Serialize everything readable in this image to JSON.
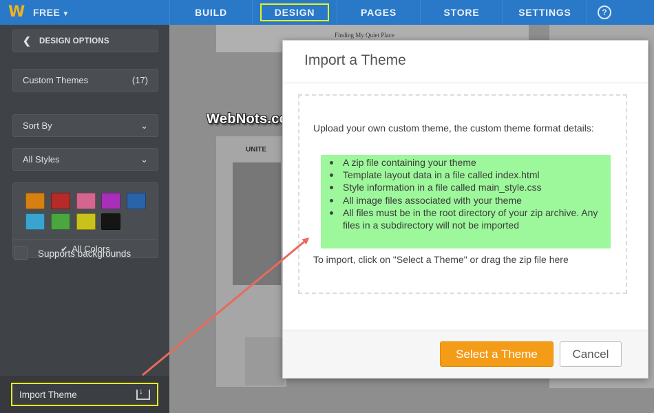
{
  "topbar": {
    "logo": "W",
    "plan": "FREE",
    "nav": [
      {
        "label": "BUILD"
      },
      {
        "label": "DESIGN"
      },
      {
        "label": "PAGES"
      },
      {
        "label": "STORE"
      },
      {
        "label": "SETTINGS"
      }
    ],
    "help": "?"
  },
  "sidebar": {
    "back_label": "DESIGN OPTIONS",
    "custom_themes_label": "Custom Themes",
    "custom_themes_count": "(17)",
    "sort_label": "Sort By",
    "styles_label": "All Styles",
    "swatch_colors": [
      "#d5800f",
      "#b62a27",
      "#d3658f",
      "#a92fbb",
      "#2963a9",
      "#3aa3cf",
      "#4aa63f",
      "#c9c21b",
      "#151515"
    ],
    "all_colors_label": "All Colors",
    "supports_backgrounds_label": "Supports backgrounds",
    "import_theme_label": "Import Theme"
  },
  "background": {
    "page_heading": "Finding My Quiet Place",
    "card_heading": "UNITE"
  },
  "watermark": "WebNots.com",
  "modal": {
    "title": "Import a Theme",
    "intro": "Upload your own custom theme, the custom theme format details:",
    "requirements": [
      "A zip file containing your theme",
      "Template layout data in a file called index.html",
      "Style information in a file called main_style.css",
      "All image files associated with your theme",
      "All files must be in the root directory of your zip archive. Any files in a subdirectory will not be imported"
    ],
    "hint": "To import, click on \"Select a Theme\" or drag the zip file here",
    "select_label": "Select a Theme",
    "cancel_label": "Cancel"
  },
  "colors": {
    "nav_blue": "#2a79c8",
    "highlight_yellow": "#e7f21e",
    "requirements_green": "#9df79b",
    "primary_orange": "#f49c18",
    "annotation_arrow": "#e96a5c"
  }
}
